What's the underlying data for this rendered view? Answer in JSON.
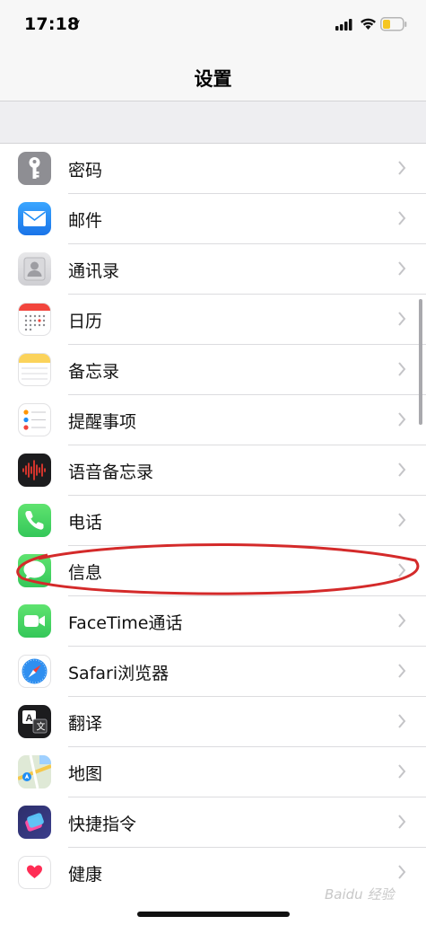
{
  "status_bar": {
    "time": "17:18"
  },
  "nav": {
    "title": "设置"
  },
  "rows": [
    {
      "label": "密码",
      "icon": "key-icon"
    },
    {
      "label": "邮件",
      "icon": "mail-icon"
    },
    {
      "label": "通讯录",
      "icon": "contacts-icon"
    },
    {
      "label": "日历",
      "icon": "calendar-icon"
    },
    {
      "label": "备忘录",
      "icon": "notes-icon"
    },
    {
      "label": "提醒事项",
      "icon": "reminders-icon"
    },
    {
      "label": "语音备忘录",
      "icon": "voice-memos-icon"
    },
    {
      "label": "电话",
      "icon": "phone-icon"
    },
    {
      "label": "信息",
      "icon": "messages-icon"
    },
    {
      "label": "FaceTime通话",
      "icon": "facetime-icon"
    },
    {
      "label": "Safari浏览器",
      "icon": "safari-icon"
    },
    {
      "label": "翻译",
      "icon": "translate-icon"
    },
    {
      "label": "地图",
      "icon": "maps-icon"
    },
    {
      "label": "快捷指令",
      "icon": "shortcuts-icon"
    },
    {
      "label": "健康",
      "icon": "health-icon"
    }
  ],
  "colors": {
    "accent_annotation": "#d42a2a",
    "battery_level": "#f5c623",
    "phone_green": "#4cd964",
    "mail_blue": "#1f8ef5"
  },
  "watermark": "Baidu 经验"
}
